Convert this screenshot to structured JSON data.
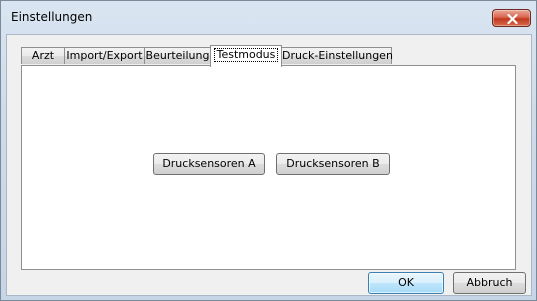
{
  "window": {
    "title": "Einstellungen",
    "close_icon": "close-icon"
  },
  "tabs": [
    {
      "label": "Arzt",
      "active": false
    },
    {
      "label": "Import/Export",
      "active": false
    },
    {
      "label": "Beurteilung",
      "active": false
    },
    {
      "label": "Testmodus",
      "active": true
    },
    {
      "label": "Druck-Einstellungen",
      "active": false
    }
  ],
  "panel": {
    "button_a": "Drucksensoren A",
    "button_b": "Drucksensoren B"
  },
  "footer": {
    "ok_label": "OK",
    "cancel_label": "Abbruch"
  },
  "colors": {
    "close_button": "#c7432a",
    "default_button_border": "#3c7fb1"
  }
}
